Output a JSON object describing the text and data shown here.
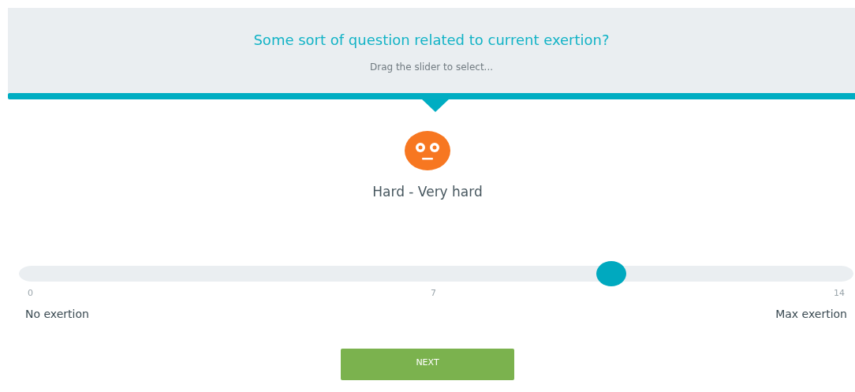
{
  "header": {
    "question": "Some sort of question related to current exertion?",
    "hint": "Drag the slider to select..."
  },
  "mood": {
    "label": "Hard - Very hard"
  },
  "slider": {
    "level": 0.71,
    "ticks": [
      "0",
      "7",
      "14"
    ],
    "min_label": "No exertion",
    "max_label": "Max exertion"
  },
  "buttons": [
    "NEXT"
  ]
}
